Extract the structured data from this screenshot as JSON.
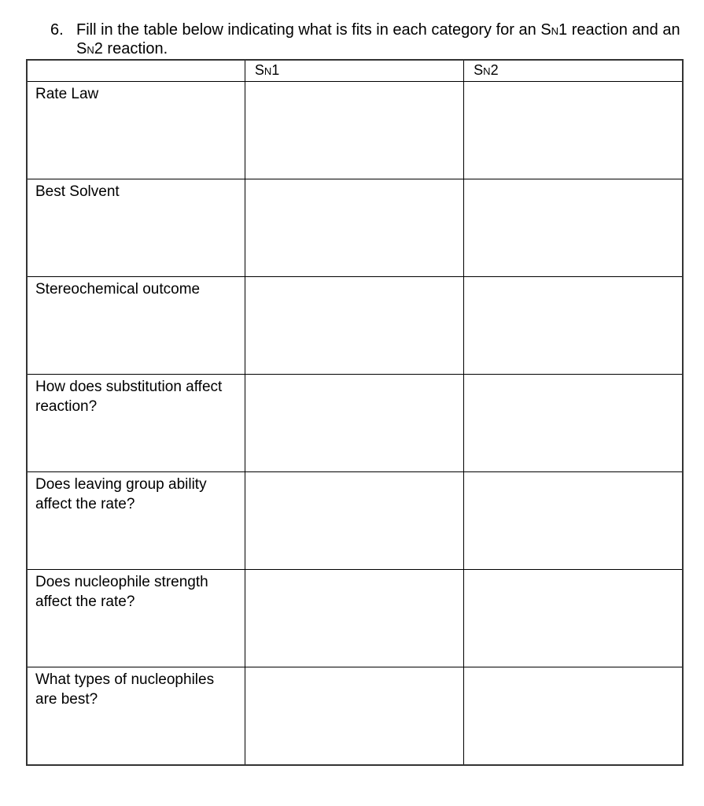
{
  "question": {
    "number": "6.",
    "text_before_sn1": "Fill in the table below indicating what is fits in each category for an ",
    "sn1_s": "S",
    "sn1_sub": "N",
    "sn1_num": "1",
    "text_middle": " reaction and an ",
    "sn2_s": "S",
    "sn2_sub": "N",
    "sn2_num": "2",
    "text_after": " reaction."
  },
  "table": {
    "headers": [
      {
        "label": ""
      },
      {
        "s": "S",
        "sub": "N",
        "num": "1"
      },
      {
        "s": "S",
        "sub": "N",
        "num": "2"
      }
    ],
    "rows": [
      {
        "label": "Rate Law",
        "sn1": "",
        "sn2": ""
      },
      {
        "label": "Best Solvent",
        "sn1": "",
        "sn2": ""
      },
      {
        "label": "Stereochemical outcome",
        "sn1": "",
        "sn2": ""
      },
      {
        "label": "How does substitution affect reaction?",
        "sn1": "",
        "sn2": ""
      },
      {
        "label": "Does leaving group ability affect the rate?",
        "sn1": "",
        "sn2": ""
      },
      {
        "label": "Does nucleophile strength affect the rate?",
        "sn1": "",
        "sn2": ""
      },
      {
        "label": "What types of nucleophiles are best?",
        "sn1": "",
        "sn2": ""
      }
    ]
  }
}
